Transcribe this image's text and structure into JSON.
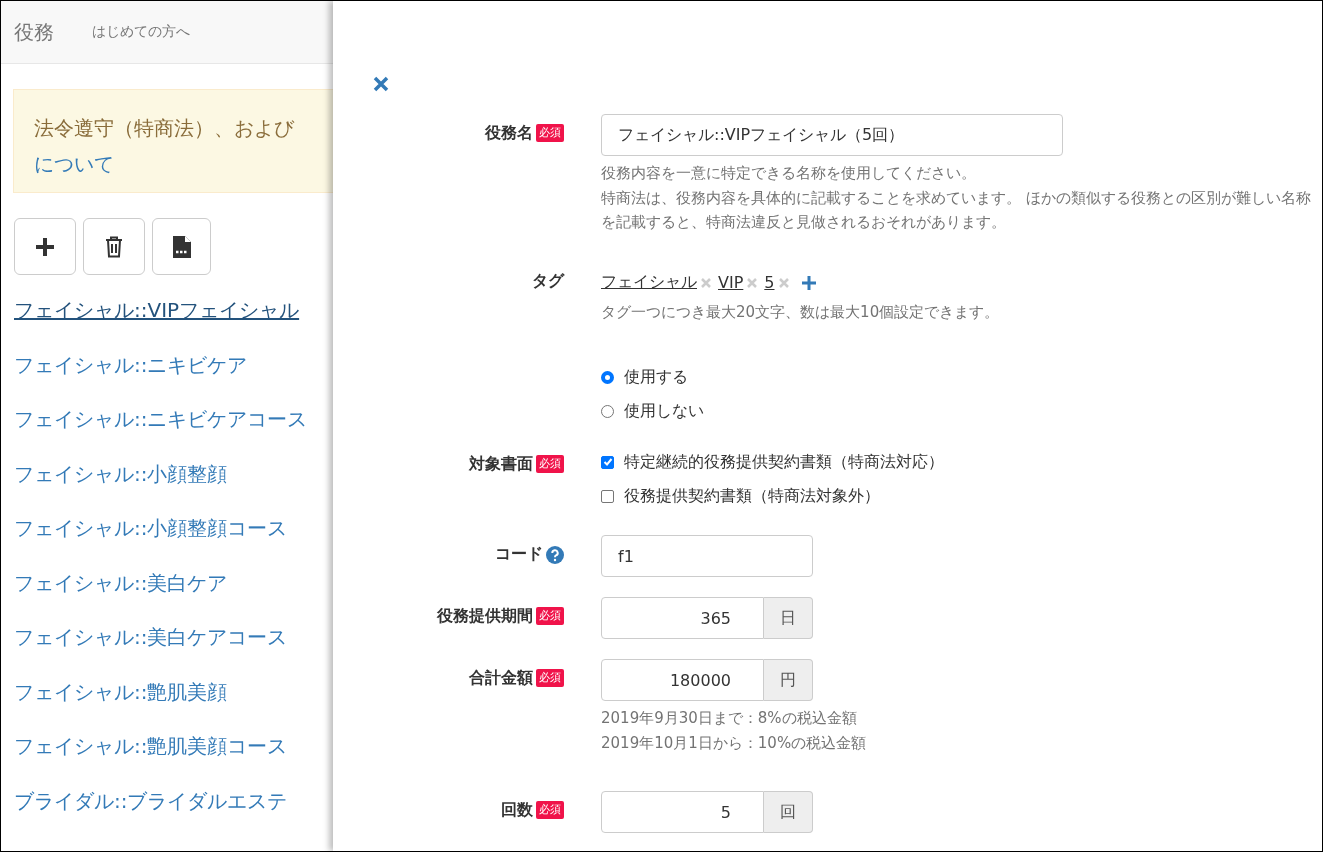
{
  "header": {
    "title": "役務",
    "link": "はじめての方へ"
  },
  "notice": {
    "text": "法令遵守（特商法）、および",
    "link": "について"
  },
  "items": [
    {
      "label": "フェイシャル::VIPフェイシャル",
      "selected": true
    },
    {
      "label": "フェイシャル::ニキビケア",
      "selected": false
    },
    {
      "label": "フェイシャル::ニキビケアコース",
      "selected": false
    },
    {
      "label": "フェイシャル::小顔整顔",
      "selected": false
    },
    {
      "label": "フェイシャル::小顔整顔コース",
      "selected": false
    },
    {
      "label": "フェイシャル::美白ケア",
      "selected": false
    },
    {
      "label": "フェイシャル::美白ケアコース",
      "selected": false
    },
    {
      "label": "フェイシャル::艶肌美顔",
      "selected": false
    },
    {
      "label": "フェイシャル::艶肌美顔コース",
      "selected": false
    },
    {
      "label": "ブライダル::ブライダルエステ",
      "selected": false
    }
  ],
  "rows": [
    {
      "kind": "text",
      "label": "役務名",
      "badge": "必須",
      "value": "フェイシャル::VIPフェイシャル（5回）",
      "help": [
        "役務内容を一意に特定できる名称を使用してください。",
        "特商法は、役務内容を具体的に記載することを求めています。 ほかの類似する役務との区別が難しい名称を記載すると、特商法違反と見做されるおそれがあります。"
      ]
    },
    {
      "kind": "tags",
      "label": "タグ",
      "tags": [
        "フェイシャル",
        "VIP",
        "5"
      ],
      "help": [
        "タグ一つにつき最大20文字、数は最大10個設定できます。"
      ]
    },
    {
      "kind": "radio",
      "options": [
        {
          "label": "使用する",
          "selected": true
        },
        {
          "label": "使用しない",
          "selected": false
        }
      ]
    },
    {
      "kind": "checks",
      "label": "対象書面",
      "badge": "必須",
      "options": [
        {
          "label": "特定継続的役務提供契約書類（特商法対応）",
          "checked": true
        },
        {
          "label": "役務提供契約書類（特商法対象外）",
          "checked": false
        }
      ]
    },
    {
      "kind": "code",
      "label": "コード",
      "help_icon": true,
      "value": "f1"
    },
    {
      "kind": "unit",
      "label": "役務提供期間",
      "badge": "必須",
      "value": "365",
      "unit": "日"
    },
    {
      "kind": "unit",
      "label": "合計金額",
      "badge": "必須",
      "value": "180000",
      "unit": "円",
      "help": [
        "2019年9月30日まで：8%の税込金額",
        "2019年10月1日から：10%の税込金額"
      ]
    },
    {
      "kind": "unit",
      "label": "回数",
      "badge": "必須",
      "value": "5",
      "unit": "回"
    }
  ]
}
